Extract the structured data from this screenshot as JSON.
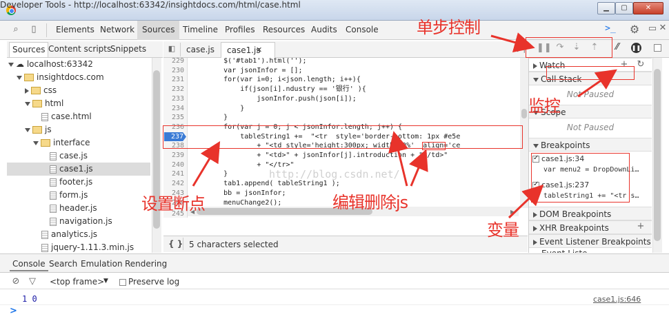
{
  "window": {
    "title": "Developer Tools - http://localhost:63342/insightdocs.com/html/case.html"
  },
  "main_tabs": [
    "Elements",
    "Network",
    "Sources",
    "Timeline",
    "Profiles",
    "Resources",
    "Audits",
    "Console"
  ],
  "sources_tabs": [
    "Sources",
    "Content scripts",
    "Snippets"
  ],
  "tree": [
    {
      "label": "localhost:63342",
      "icon": "cloud-icon"
    },
    {
      "label": "insightdocs.com",
      "icon": "folder-icon"
    },
    {
      "label": "css",
      "icon": "folder-icon"
    },
    {
      "label": "html",
      "icon": "folder-icon"
    },
    {
      "label": "case.html",
      "icon": "html-file-icon"
    },
    {
      "label": "js",
      "icon": "folder-icon"
    },
    {
      "label": "interface",
      "icon": "folder-icon"
    },
    {
      "label": "case.js",
      "icon": "file-icon"
    },
    {
      "label": "case1.js",
      "icon": "file-icon"
    },
    {
      "label": "footer.js",
      "icon": "file-icon"
    },
    {
      "label": "form.js",
      "icon": "file-icon"
    },
    {
      "label": "header.js",
      "icon": "file-icon"
    },
    {
      "label": "navigation.js",
      "icon": "file-icon"
    },
    {
      "label": "analytics.js",
      "icon": "file-icon"
    },
    {
      "label": "jquery-1.11.3.min.js",
      "icon": "file-icon"
    }
  ],
  "editor_tabs": [
    {
      "label": "case.js"
    },
    {
      "label": "case1.js"
    }
  ],
  "code": {
    "lines": [
      "229",
      "230",
      "231",
      "232",
      "233",
      "234",
      "235",
      "236",
      "237",
      "238",
      "239",
      "240",
      "241",
      "242",
      "243",
      "244",
      "245"
    ],
    "text": [
      "        $('#tab1').html('');",
      "        var jsonInfor = [];",
      "        for(var i=0; i<json.length; i++){",
      "            if(json[i].ndustry == '银行' ){",
      "                jsonInfor.push(json[i]);",
      "            }",
      "        }",
      "        for(var j = 0; j < jsonInfor.length; j++) {",
      "            tableString1 +=  \"<tr  style='border-bottom: 1px #e5e",
      "                + \"<td style='height:300px; width:20%'  align='ce",
      "                + \"<td>\" + jsonInfor[j].introduction + \"</td>\"",
      "                + \"</tr>\"",
      "        }",
      "        tab1.append( tableString1 );",
      "        bb = jsonInfor;",
      "        menuChange2();",
      ""
    ],
    "breakpoint_line": "237",
    "watermark": "http://blog.csdn.net/"
  },
  "status": {
    "text": "5 characters selected",
    "braces": "{ }"
  },
  "right_panel": {
    "watch": "Watch",
    "call_stack": "Call Stack",
    "not_paused": "Not Paused",
    "scope": "Scope",
    "breakpoints": "Breakpoints",
    "bp_items": [
      {
        "file": "case1.js:34",
        "code": "var menu2 = DropDownLi…"
      },
      {
        "file": "case1.js:237",
        "code": "tableString1 += \"<tr s…"
      }
    ],
    "dom_bp": "DOM Breakpoints",
    "xhr_bp": "XHR Breakpoints",
    "event_bp": "Event Listener Breakpoints",
    "event_partial": "Event Liste..."
  },
  "console": {
    "tabs": [
      "Console",
      "Search",
      "Emulation",
      "Rendering"
    ],
    "frame": "<top frame>",
    "preserve": "Preserve log",
    "output": "1 0",
    "source": "case1.js:646",
    "prompt": ">"
  },
  "annotations": {
    "step_control": "单步控制",
    "monitor": "监控",
    "set_breakpoint": "设置断点",
    "edit_delete": "编辑删除js",
    "variables": "变量"
  },
  "colors": {
    "annotation": "#e8332b",
    "breakpoint": "#3a7bd5",
    "selected_row": "#dcdcdc"
  }
}
